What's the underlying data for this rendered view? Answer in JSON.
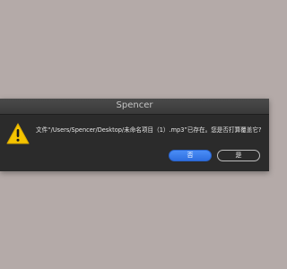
{
  "dialog": {
    "title": "Spencer",
    "message": "文件“/Users/Spencer/Desktop/未命名项目（1）.mp3”已存在。您是否打算覆盖它?",
    "icon": "warning-icon",
    "buttons": {
      "no_label": "否",
      "yes_label": "是"
    }
  },
  "colors": {
    "background": "#b4aaa8",
    "dialog": "#2b2b2b",
    "primary_button": "#3b7ff0",
    "warning": "#f5c400"
  }
}
